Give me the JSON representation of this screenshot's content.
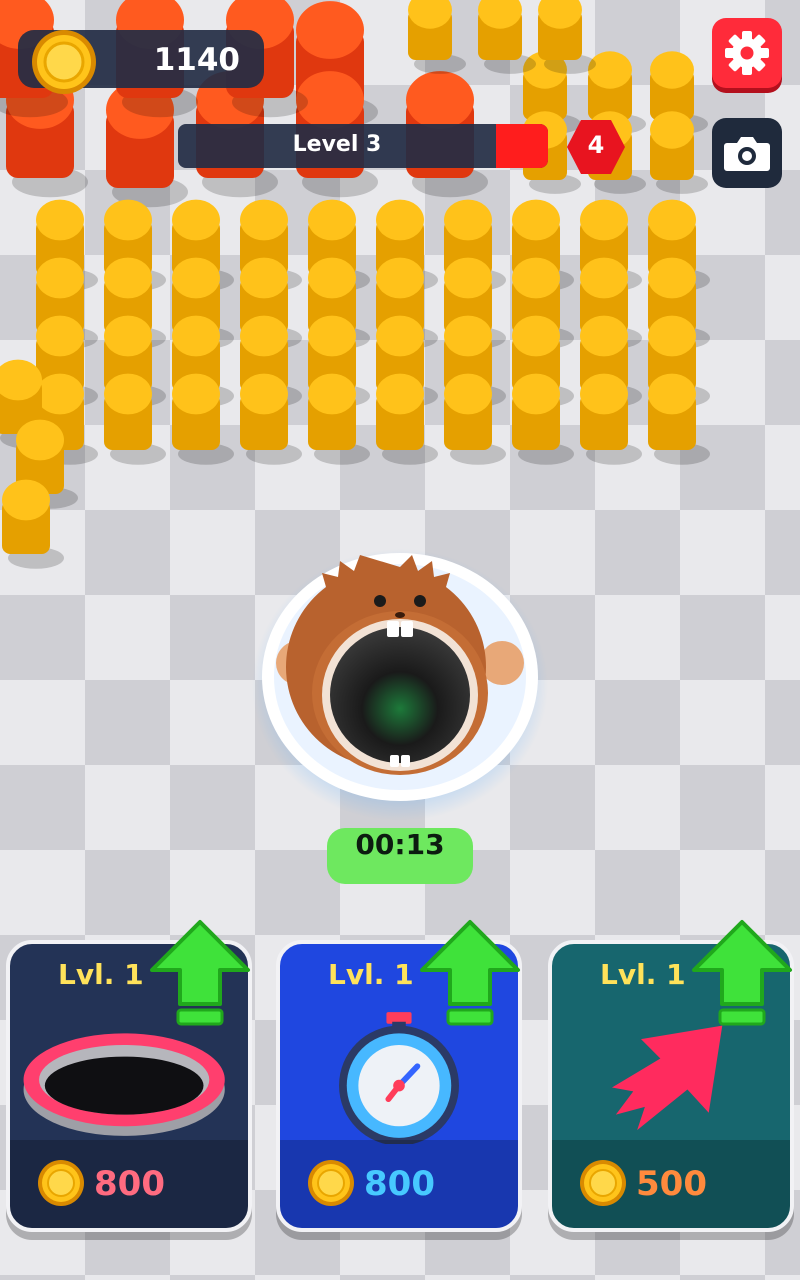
{
  "hud": {
    "coins": "1140",
    "level_label": "Level 3",
    "next_level": "4",
    "level_progress": 0.14
  },
  "hole": {
    "timer": "00:13"
  },
  "upgrades": [
    {
      "name": "hole-size",
      "level_label": "Lvl. 1",
      "price": "800",
      "bg": "#233356",
      "price_color": "#ff6b80"
    },
    {
      "name": "time",
      "level_label": "Lvl. 1",
      "price": "800",
      "bg": "#1f47e0",
      "price_color": "#47c9ff"
    },
    {
      "name": "speed",
      "level_label": "Lvl. 1",
      "price": "500",
      "bg": "#17666e",
      "price_color": "#ff8a3d"
    }
  ],
  "colors": {
    "accent_red": "#ff1d1d",
    "hud_dark": "#232d44",
    "timer_green": "#6ee85f",
    "upgrade_arrow_green": "#3fe23a",
    "level_text_yellow": "#ffe25a"
  },
  "icons": [
    "coin-icon",
    "gear-icon",
    "camera-icon",
    "hexagon-badge-icon",
    "up-arrow-icon",
    "ring-icon",
    "stopwatch-icon",
    "speed-arrow-icon"
  ]
}
